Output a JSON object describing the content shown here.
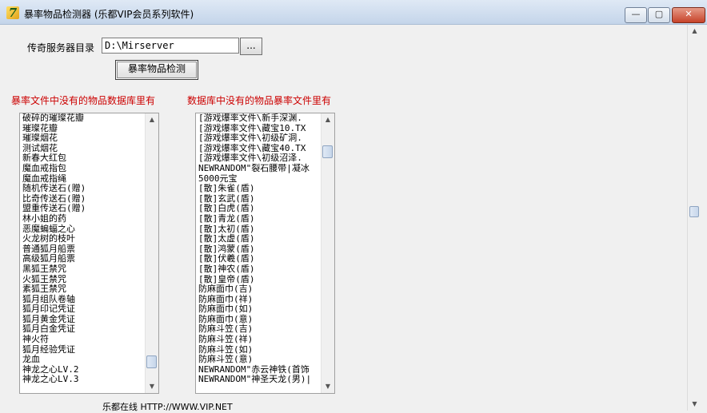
{
  "window": {
    "title": "暴率物品检测器 (乐都VIP会员系列软件)",
    "minimize_label": "—",
    "maximize_label": "▢",
    "close_label": "✕"
  },
  "form": {
    "dir_label": "传奇服务器目录",
    "dir_value": "D:\\Mirserver",
    "browse_label": "...",
    "check_button_label": "暴率物品检测"
  },
  "left_panel": {
    "heading": "暴率文件中没有的物品数据库里有",
    "items": [
      "破碎的璀璨花瓣",
      "璀璨花瓣",
      "璀璨烟花",
      "测试烟花",
      "新春大红包",
      "魔血戒指包",
      "魔血戒指绳",
      "随机传送石(赠)",
      "比奇传送石(赠)",
      "盟重传送石(赠)",
      "林小姐的药",
      "恶魔蝙蝠之心",
      "火龙树的枝叶",
      "普通狐月船票",
      "高级狐月船票",
      "黑狐王禁咒",
      "火狐王禁咒",
      "素狐王禁咒",
      "狐月组队卷轴",
      "狐月印记凭证",
      "狐月黄金凭证",
      "狐月白金凭证",
      "神火符",
      "狐月经验凭证",
      "龙血",
      "神龙之心LV.2",
      "神龙之心LV.3"
    ]
  },
  "right_panel": {
    "heading": "数据库中没有的物品暴率文件里有",
    "items": [
      "[游戏爆率文件\\新手深渊.",
      "[游戏爆率文件\\藏宝10.TX",
      "[游戏爆率文件\\初级矿洞.",
      "[游戏爆率文件\\藏宝40.TX",
      "[游戏爆率文件\\初级沼泽.",
      "NEWRANDOM\"裂石腰带|凝冰",
      "5000元宝",
      "[散]朱雀(盾)",
      "[散]玄武(盾)",
      "[散]白虎(盾)",
      "[散]青龙(盾)",
      "[散]太初(盾)",
      "[散]太虚(盾)",
      "[散]鸿蒙(盾)",
      "[散]伏羲(盾)",
      "[散]神农(盾)",
      "[散]皇帝(盾)",
      "防麻面巾(吉)",
      "防麻面巾(祥)",
      "防麻面巾(如)",
      "防麻面巾(意)",
      "防麻斗笠(吉)",
      "防麻斗笠(祥)",
      "防麻斗笠(如)",
      "防麻斗笠(意)",
      "NEWRANDOM\"赤云神铁(首饰",
      "NEWRANDOM\"神圣天龙(男)|"
    ]
  },
  "footer": {
    "text": "乐都在线 HTTP://WWW.VIP.NET"
  },
  "scroll": {
    "left_position_fraction": 0.95,
    "right_position_fraction": 0.08
  }
}
